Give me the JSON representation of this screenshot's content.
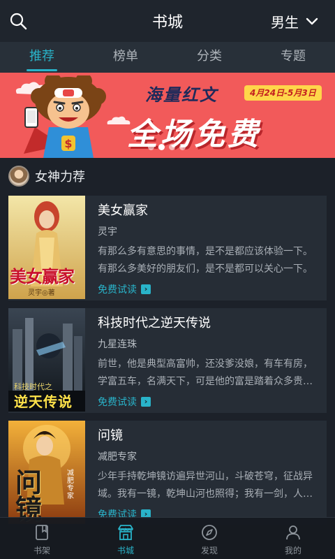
{
  "header": {
    "title": "书城",
    "gender_selector": "男生"
  },
  "tabs": [
    {
      "label": "推荐",
      "active": true
    },
    {
      "label": "榜单",
      "active": false
    },
    {
      "label": "分类",
      "active": false
    },
    {
      "label": "专题",
      "active": false
    }
  ],
  "banner": {
    "heading": "海量红文",
    "date_range": "4月24日-5月3日",
    "main_text": "全场免费",
    "slide_index": 2,
    "slide_count": 4
  },
  "section": {
    "title": "女神力荐"
  },
  "books": [
    {
      "title": "美女赢家",
      "author": "灵宇",
      "description": "有那么多有意思的事情，是不是都应该体验一下。有那么多美好的朋友们，是不是都可以关心一下。",
      "free_label": "免费试读",
      "cover_text": "美女赢家",
      "cover_author": "灵宇◎著"
    },
    {
      "title": "科技时代之逆天传说",
      "author": "九星连珠",
      "description": "前世，他是典型高富帅，还没爹没娘，有车有房，学富五车，名满天下，可是他的富是踏着众多贵…",
      "free_label": "免费试读",
      "cover_text": "逆天传说",
      "cover_author": "科技时代之"
    },
    {
      "title": "问镜",
      "author": "减肥专家",
      "description": "少年手持乾坤镜访遍异世河山，斗破苍穹，征战异域。我有一镜，乾坤山河也照得；我有一剑，人…",
      "free_label": "免费试读",
      "cover_text": "问镜",
      "cover_author": "减肥专家"
    }
  ],
  "bottom_nav": [
    {
      "label": "书架",
      "icon": "bookshelf-icon",
      "active": false
    },
    {
      "label": "书城",
      "icon": "bookstore-icon",
      "active": true
    },
    {
      "label": "发现",
      "icon": "compass-icon",
      "active": false
    },
    {
      "label": "我的",
      "icon": "profile-icon",
      "active": false
    }
  ],
  "colors": {
    "accent": "#29b3c9",
    "banner": "#f25a5a",
    "background": "#1c2129"
  }
}
